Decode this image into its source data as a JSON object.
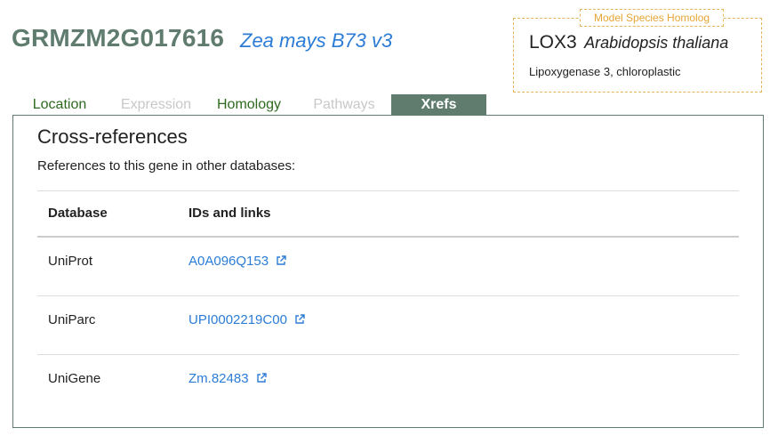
{
  "gene": {
    "id": "GRMZM2G017616",
    "species": "Zea mays B73 v3"
  },
  "homolog": {
    "legend": "Model Species Homolog",
    "symbol": "LOX3",
    "species": "Arabidopsis thaliana",
    "description": "Lipoxygenase 3, chloroplastic"
  },
  "tabs": [
    {
      "label": "Location",
      "state": "enabled"
    },
    {
      "label": "Expression",
      "state": "disabled"
    },
    {
      "label": "Homology",
      "state": "enabled"
    },
    {
      "label": "Pathways",
      "state": "disabled"
    },
    {
      "label": "Xrefs",
      "state": "active"
    }
  ],
  "panel": {
    "title": "Cross-references",
    "subtitle": "References to this gene in other databases:",
    "columns": [
      "Database",
      "IDs and links"
    ],
    "rows": [
      {
        "database": "UniProt",
        "id": "A0A096Q153"
      },
      {
        "database": "UniParc",
        "id": "UPI0002219C00"
      },
      {
        "database": "UniGene",
        "id": "Zm.82483"
      }
    ]
  },
  "colors": {
    "brand_green": "#5f7c6f",
    "link_blue": "#2b7cd6",
    "tab_green": "#2d6a1e",
    "homolog_orange": "#e5a636"
  },
  "icons": {
    "external_link": "external-link-icon"
  }
}
